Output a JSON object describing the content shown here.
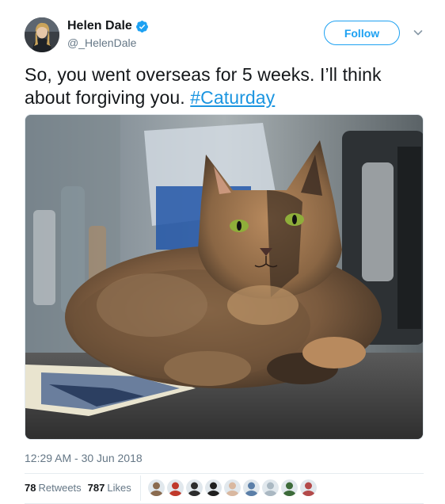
{
  "author": {
    "name": "Helen Dale",
    "handle": "@_HelenDale",
    "verified": true,
    "avatar_icon": "user-avatar-icon"
  },
  "follow_label": "Follow",
  "tweet": {
    "text": "So, you went overseas for 5 weeks. I’ll think about forgiving you. ",
    "hashtag": "#Caturday",
    "photo_alt": "Photo of a tortoiseshell cat sitting on a kitchen bench"
  },
  "timestamp": "12:29 AM - 30 Jun 2018",
  "stats": {
    "retweets_count": "78",
    "retweets_label": "Retweets",
    "likes_count": "787",
    "likes_label": "Likes"
  },
  "colors": {
    "accent": "#1da1f2",
    "link": "#1b95e0",
    "secondary_text": "#657786"
  },
  "likers": [
    {
      "name": "liker-avatar-1",
      "color": "#8a6b4f"
    },
    {
      "name": "liker-avatar-2",
      "color": "#c0392b"
    },
    {
      "name": "liker-avatar-3",
      "color": "#2c2c2c"
    },
    {
      "name": "liker-avatar-4",
      "color": "#1f1f1f"
    },
    {
      "name": "liker-avatar-5",
      "color": "#d9b8a0"
    },
    {
      "name": "liker-avatar-6",
      "color": "#5b7fa8"
    },
    {
      "name": "liker-avatar-7",
      "color": "#aab8c2"
    },
    {
      "name": "liker-avatar-8",
      "color": "#3d6b3a"
    },
    {
      "name": "liker-avatar-9",
      "color": "#b34a4a"
    }
  ]
}
